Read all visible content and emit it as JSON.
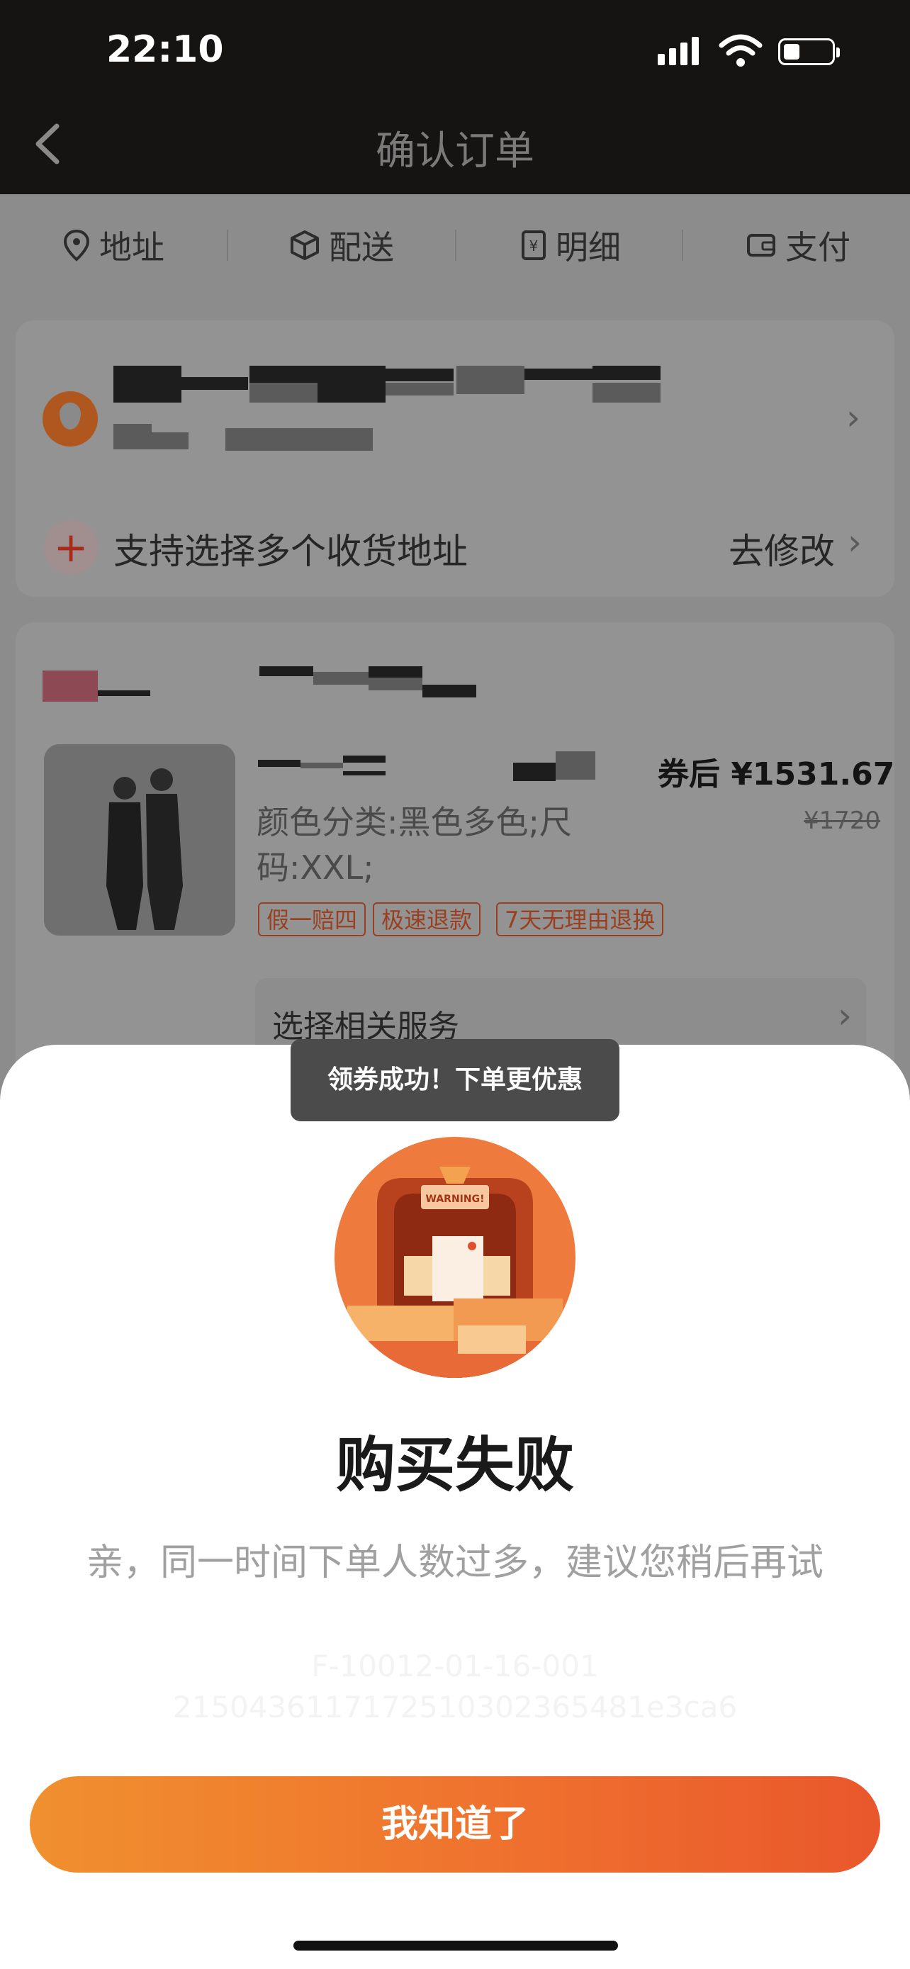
{
  "status_bar": {
    "time": "22:10"
  },
  "nav": {
    "title": "确认订单"
  },
  "steps": [
    {
      "icon": "location-pin-icon",
      "label": "地址"
    },
    {
      "icon": "package-box-icon",
      "label": "配送"
    },
    {
      "icon": "receipt-yen-icon",
      "label": "明细"
    },
    {
      "icon": "wallet-icon",
      "label": "支付"
    }
  ],
  "address": {
    "multi_label": "支持选择多个收货地址",
    "modify_label": "去修改"
  },
  "product": {
    "price_label": "券后 ¥1531.67",
    "original_price": "¥1720",
    "variant": "颜色分类:黑色多色;尺码:XXL;",
    "tags": [
      "假一赔四",
      "极速退款",
      "7天无理由退换"
    ],
    "service_label": "选择相关服务"
  },
  "modal": {
    "toast": "领券成功！下单更优惠",
    "title": "购买失败",
    "message": "亲，同一时间下单人数过多，建议您稍后再试",
    "code_line1": "F-10012-01-16-001",
    "code_line2": "2150436117172510302365481e3ca6",
    "button_label": "我知道了",
    "illustration_text": "WARNING!"
  }
}
